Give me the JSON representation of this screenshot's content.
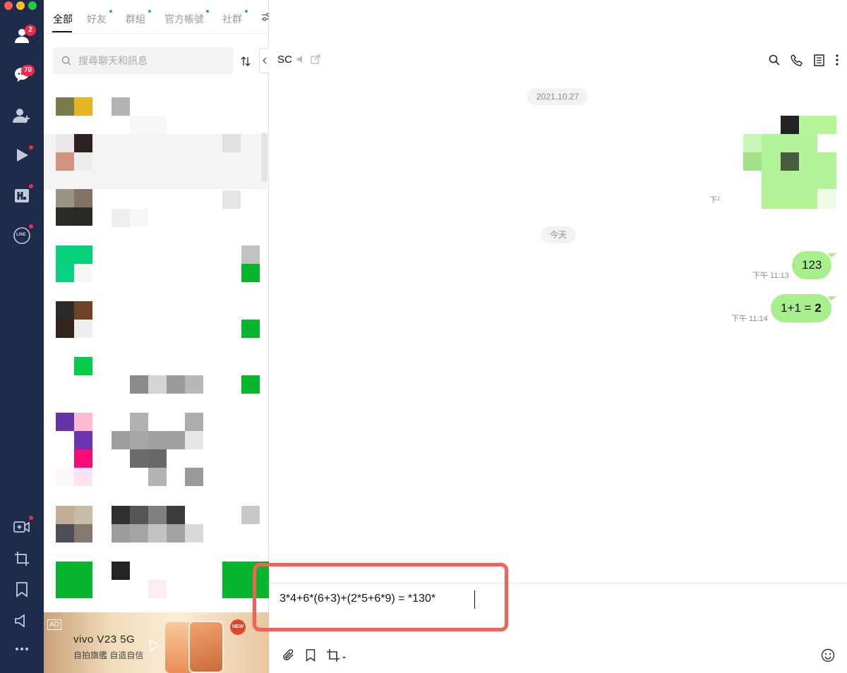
{
  "rail": {
    "friends_badge": "2",
    "chats_badge": "70",
    "line_icon_text": "LINE"
  },
  "tabs": [
    "全部",
    "好友",
    "群組",
    "官方帳號",
    "社群"
  ],
  "search": {
    "placeholder": "搜尋聊天和訊息"
  },
  "ad": {
    "tag": "AD",
    "brand": "vivo V23 5G",
    "slogan": "自拍旗艦 自造自信",
    "new_label": "NEW"
  },
  "conversation": {
    "title": "SC",
    "date_1": "2021.10.27",
    "image_time": "下午",
    "date_2": "今天",
    "messages": [
      {
        "text": "123",
        "time": "下午 11:13"
      },
      {
        "text_prefix": "1+1 = ",
        "text_bold": "2",
        "time": "下午 11:14"
      }
    ],
    "compose_text": "3*4+6*(6+3)+(2*5+6*9) = *130*"
  },
  "colors": {
    "rail_bg": "#1e2b4b",
    "bubble": "#a9ee8d",
    "badge": "#f5284a",
    "highlight": "#f0625a",
    "online_dot": "#06c755"
  }
}
